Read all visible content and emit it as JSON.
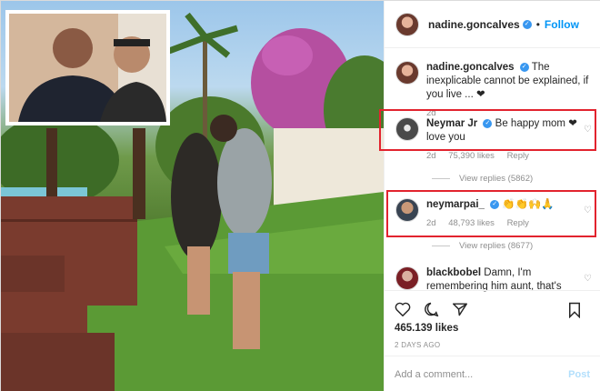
{
  "header": {
    "username": "nadine.goncalves",
    "separator": "•",
    "follow_label": "Follow"
  },
  "caption": {
    "username": "nadine.goncalves",
    "text": "The inexplicable cannot be explained, if you live ... ❤",
    "time": "2d"
  },
  "comments": [
    {
      "username": "Neymar Jr",
      "text": "Be happy mom ❤ love you",
      "time": "2d",
      "likes": "75,390 likes",
      "reply": "Reply",
      "view_replies": "View replies (5862)"
    },
    {
      "username": "neymarpai_",
      "text": "👏👏🙌🙏",
      "time": "2d",
      "likes": "48,793 likes",
      "reply": "Reply",
      "view_replies": "View replies (8677)"
    },
    {
      "username": "blackbobel",
      "text": "Damn, I'm remembering him aunt, that's"
    }
  ],
  "post": {
    "likes_count": "465.139 likes",
    "posted_ago": "2 DAYS AGO"
  },
  "add_comment": {
    "placeholder": "Add a comment...",
    "post_label": "Post"
  },
  "icons": [
    "heart-icon",
    "comment-icon",
    "share-icon",
    "bookmark-icon",
    "verified-icon"
  ],
  "colors": {
    "accent": "#0095f6",
    "highlight_box": "#e2232e",
    "like_heart": "#ed1c24"
  }
}
